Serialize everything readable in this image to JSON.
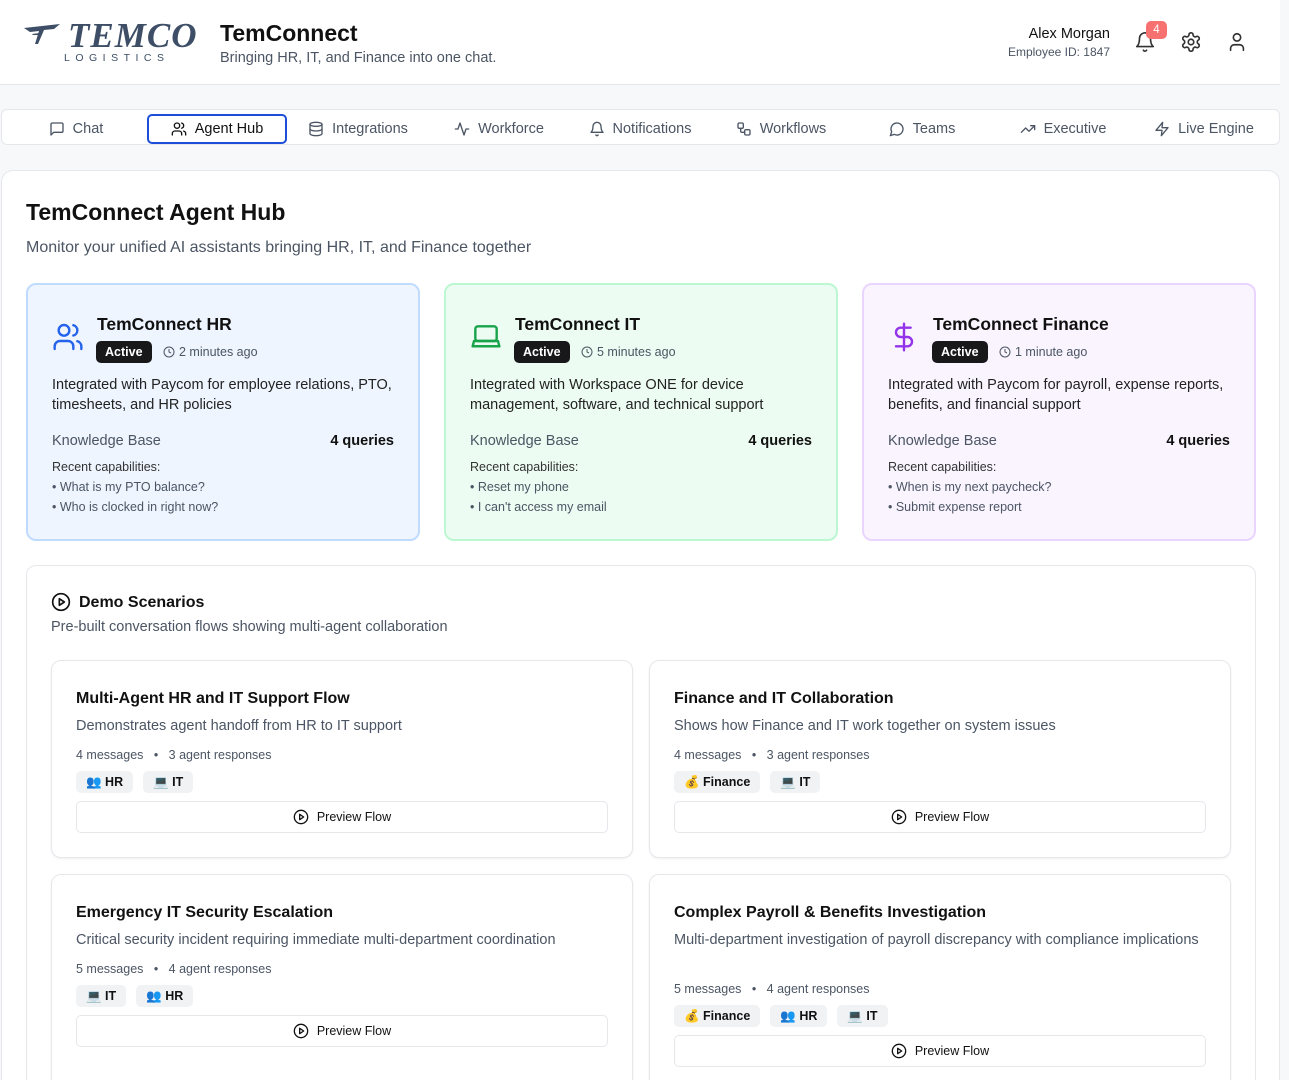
{
  "header": {
    "logo_text": "TEMCO",
    "logo_sub": "LOGISTICS",
    "app_title": "TemConnect",
    "app_subtitle": "Bringing HR, IT, and Finance into one chat.",
    "user_name": "Alex Morgan",
    "employee_id": "Employee ID: 1847",
    "notification_count": "4",
    "icons": [
      "bell-icon",
      "gear-icon",
      "user-icon"
    ]
  },
  "tabs": [
    {
      "label": "Chat",
      "icon": "message-square-icon",
      "active": false
    },
    {
      "label": "Agent Hub",
      "icon": "users-icon",
      "active": true
    },
    {
      "label": "Integrations",
      "icon": "database-icon",
      "active": false
    },
    {
      "label": "Workforce",
      "icon": "activity-icon",
      "active": false
    },
    {
      "label": "Notifications",
      "icon": "bell-icon",
      "active": false
    },
    {
      "label": "Workflows",
      "icon": "workflow-icon",
      "active": false
    },
    {
      "label": "Teams",
      "icon": "message-circle-icon",
      "active": false
    },
    {
      "label": "Executive",
      "icon": "trending-up-icon",
      "active": false
    },
    {
      "label": "Live Engine",
      "icon": "zap-icon",
      "active": false
    }
  ],
  "page": {
    "title": "TemConnect Agent Hub",
    "subtitle": "Monitor your unified AI assistants bringing HR, IT, and Finance together"
  },
  "agents": [
    {
      "name": "TemConnect HR",
      "status": "Active",
      "last_active": "2 minutes ago",
      "description": "Integrated with Paycom for employee relations, PTO, timesheets, and HR policies",
      "kb_label": "Knowledge Base",
      "kb_value": "4 queries",
      "cap_label": "Recent capabilities:",
      "capabilities": [
        "• What is my PTO balance?",
        "• Who is clocked in right now?"
      ],
      "icon": "users-icon",
      "color": "#2563eb"
    },
    {
      "name": "TemConnect IT",
      "status": "Active",
      "last_active": "5 minutes ago",
      "description": "Integrated with Workspace ONE for device management, software, and technical support",
      "kb_label": "Knowledge Base",
      "kb_value": "4 queries",
      "cap_label": "Recent capabilities:",
      "capabilities": [
        "• Reset my phone",
        "• I can't access my email"
      ],
      "icon": "laptop-icon",
      "color": "#16a34a"
    },
    {
      "name": "TemConnect Finance",
      "status": "Active",
      "last_active": "1 minute ago",
      "description": "Integrated with Paycom for payroll, expense reports, benefits, and financial support",
      "kb_label": "Knowledge Base",
      "kb_value": "4 queries",
      "cap_label": "Recent capabilities:",
      "capabilities": [
        "• When is my next paycheck?",
        "• Submit expense report"
      ],
      "icon": "dollar-icon",
      "color": "#9333ea"
    }
  ],
  "demo": {
    "title": "Demo Scenarios",
    "subtitle": "Pre-built conversation flows showing multi-agent collaboration",
    "preview_label": "Preview Flow",
    "scenarios": [
      {
        "title": "Multi-Agent HR and IT Support Flow",
        "description": "Demonstrates agent handoff from HR to IT support",
        "messages": "4 messages",
        "responses": "3 agent responses",
        "chips": [
          "👥 HR",
          "💻 IT"
        ]
      },
      {
        "title": "Finance and IT Collaboration",
        "description": "Shows how Finance and IT work together on system issues",
        "messages": "4 messages",
        "responses": "3 agent responses",
        "chips": [
          "💰 Finance",
          "💻 IT"
        ]
      },
      {
        "title": "Emergency IT Security Escalation",
        "description": "Critical security incident requiring immediate multi-department coordination",
        "messages": "5 messages",
        "responses": "4 agent responses",
        "chips": [
          "💻 IT",
          "👥 HR"
        ]
      },
      {
        "title": "Complex Payroll & Benefits Investigation",
        "description": "Multi-department investigation of payroll discrepancy with compliance implications",
        "messages": "5 messages",
        "responses": "4 agent responses",
        "chips": [
          "💰 Finance",
          "👥 HR",
          "💻 IT"
        ]
      }
    ]
  }
}
